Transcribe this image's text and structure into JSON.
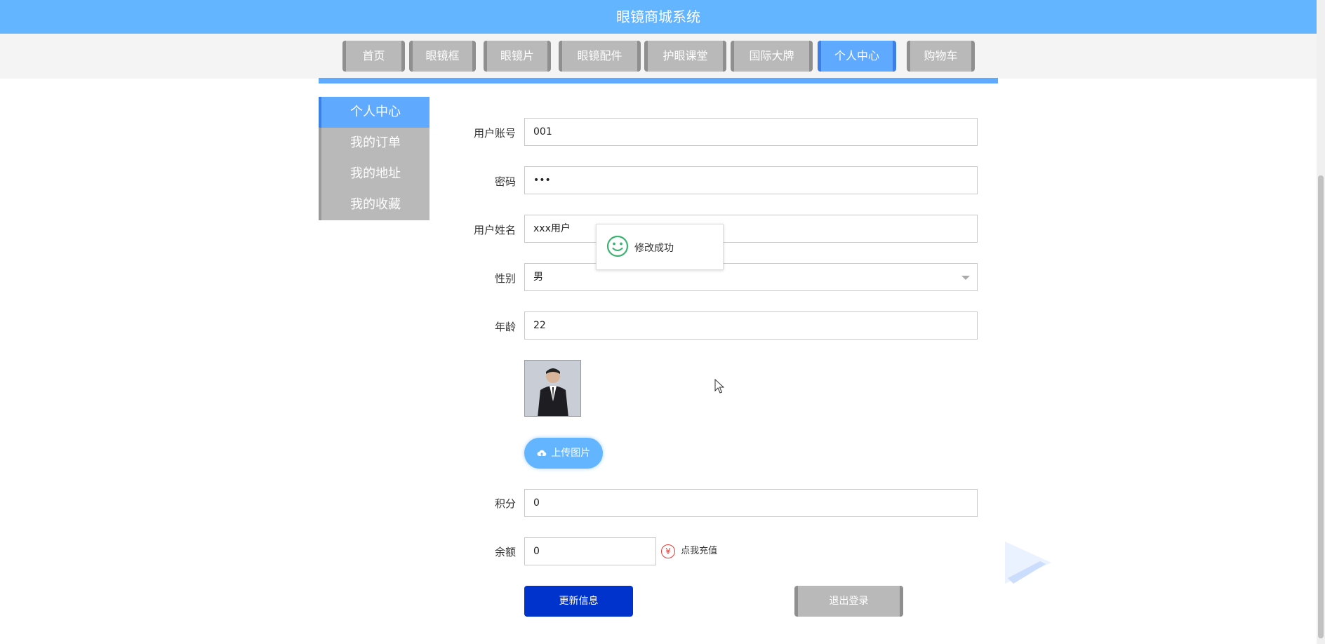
{
  "header": {
    "title": "眼镜商城系统"
  },
  "nav": {
    "items": [
      {
        "label": "首页"
      },
      {
        "label": "眼镜框"
      },
      {
        "label": "眼镜片"
      },
      {
        "label": "眼镜配件"
      },
      {
        "label": "护眼课堂"
      },
      {
        "label": "国际大牌"
      },
      {
        "label": "个人中心",
        "active": true
      },
      {
        "label": "购物车"
      }
    ]
  },
  "sidebar": {
    "items": [
      {
        "label": "个人中心",
        "active": true
      },
      {
        "label": "我的订单"
      },
      {
        "label": "我的地址"
      },
      {
        "label": "我的收藏"
      }
    ]
  },
  "form": {
    "account": {
      "label": "用户账号",
      "value": "001"
    },
    "password": {
      "label": "密码",
      "value": "•••"
    },
    "name": {
      "label": "用户姓名",
      "value": "xxx用户"
    },
    "gender": {
      "label": "性别",
      "value": "男"
    },
    "age": {
      "label": "年龄",
      "value": "22"
    },
    "upload_label": "上传图片",
    "points": {
      "label": "积分",
      "value": "0"
    },
    "balance": {
      "label": "余额",
      "value": "0"
    },
    "recharge_label": "点我充值",
    "update_label": "更新信息",
    "logout_label": "退出登录"
  },
  "toast": {
    "message": "修改成功"
  },
  "colors": {
    "primary": "#64b5ff",
    "active": "#5fa9ff",
    "update_button": "#0033cc",
    "inactive": "#b9b9b9"
  }
}
